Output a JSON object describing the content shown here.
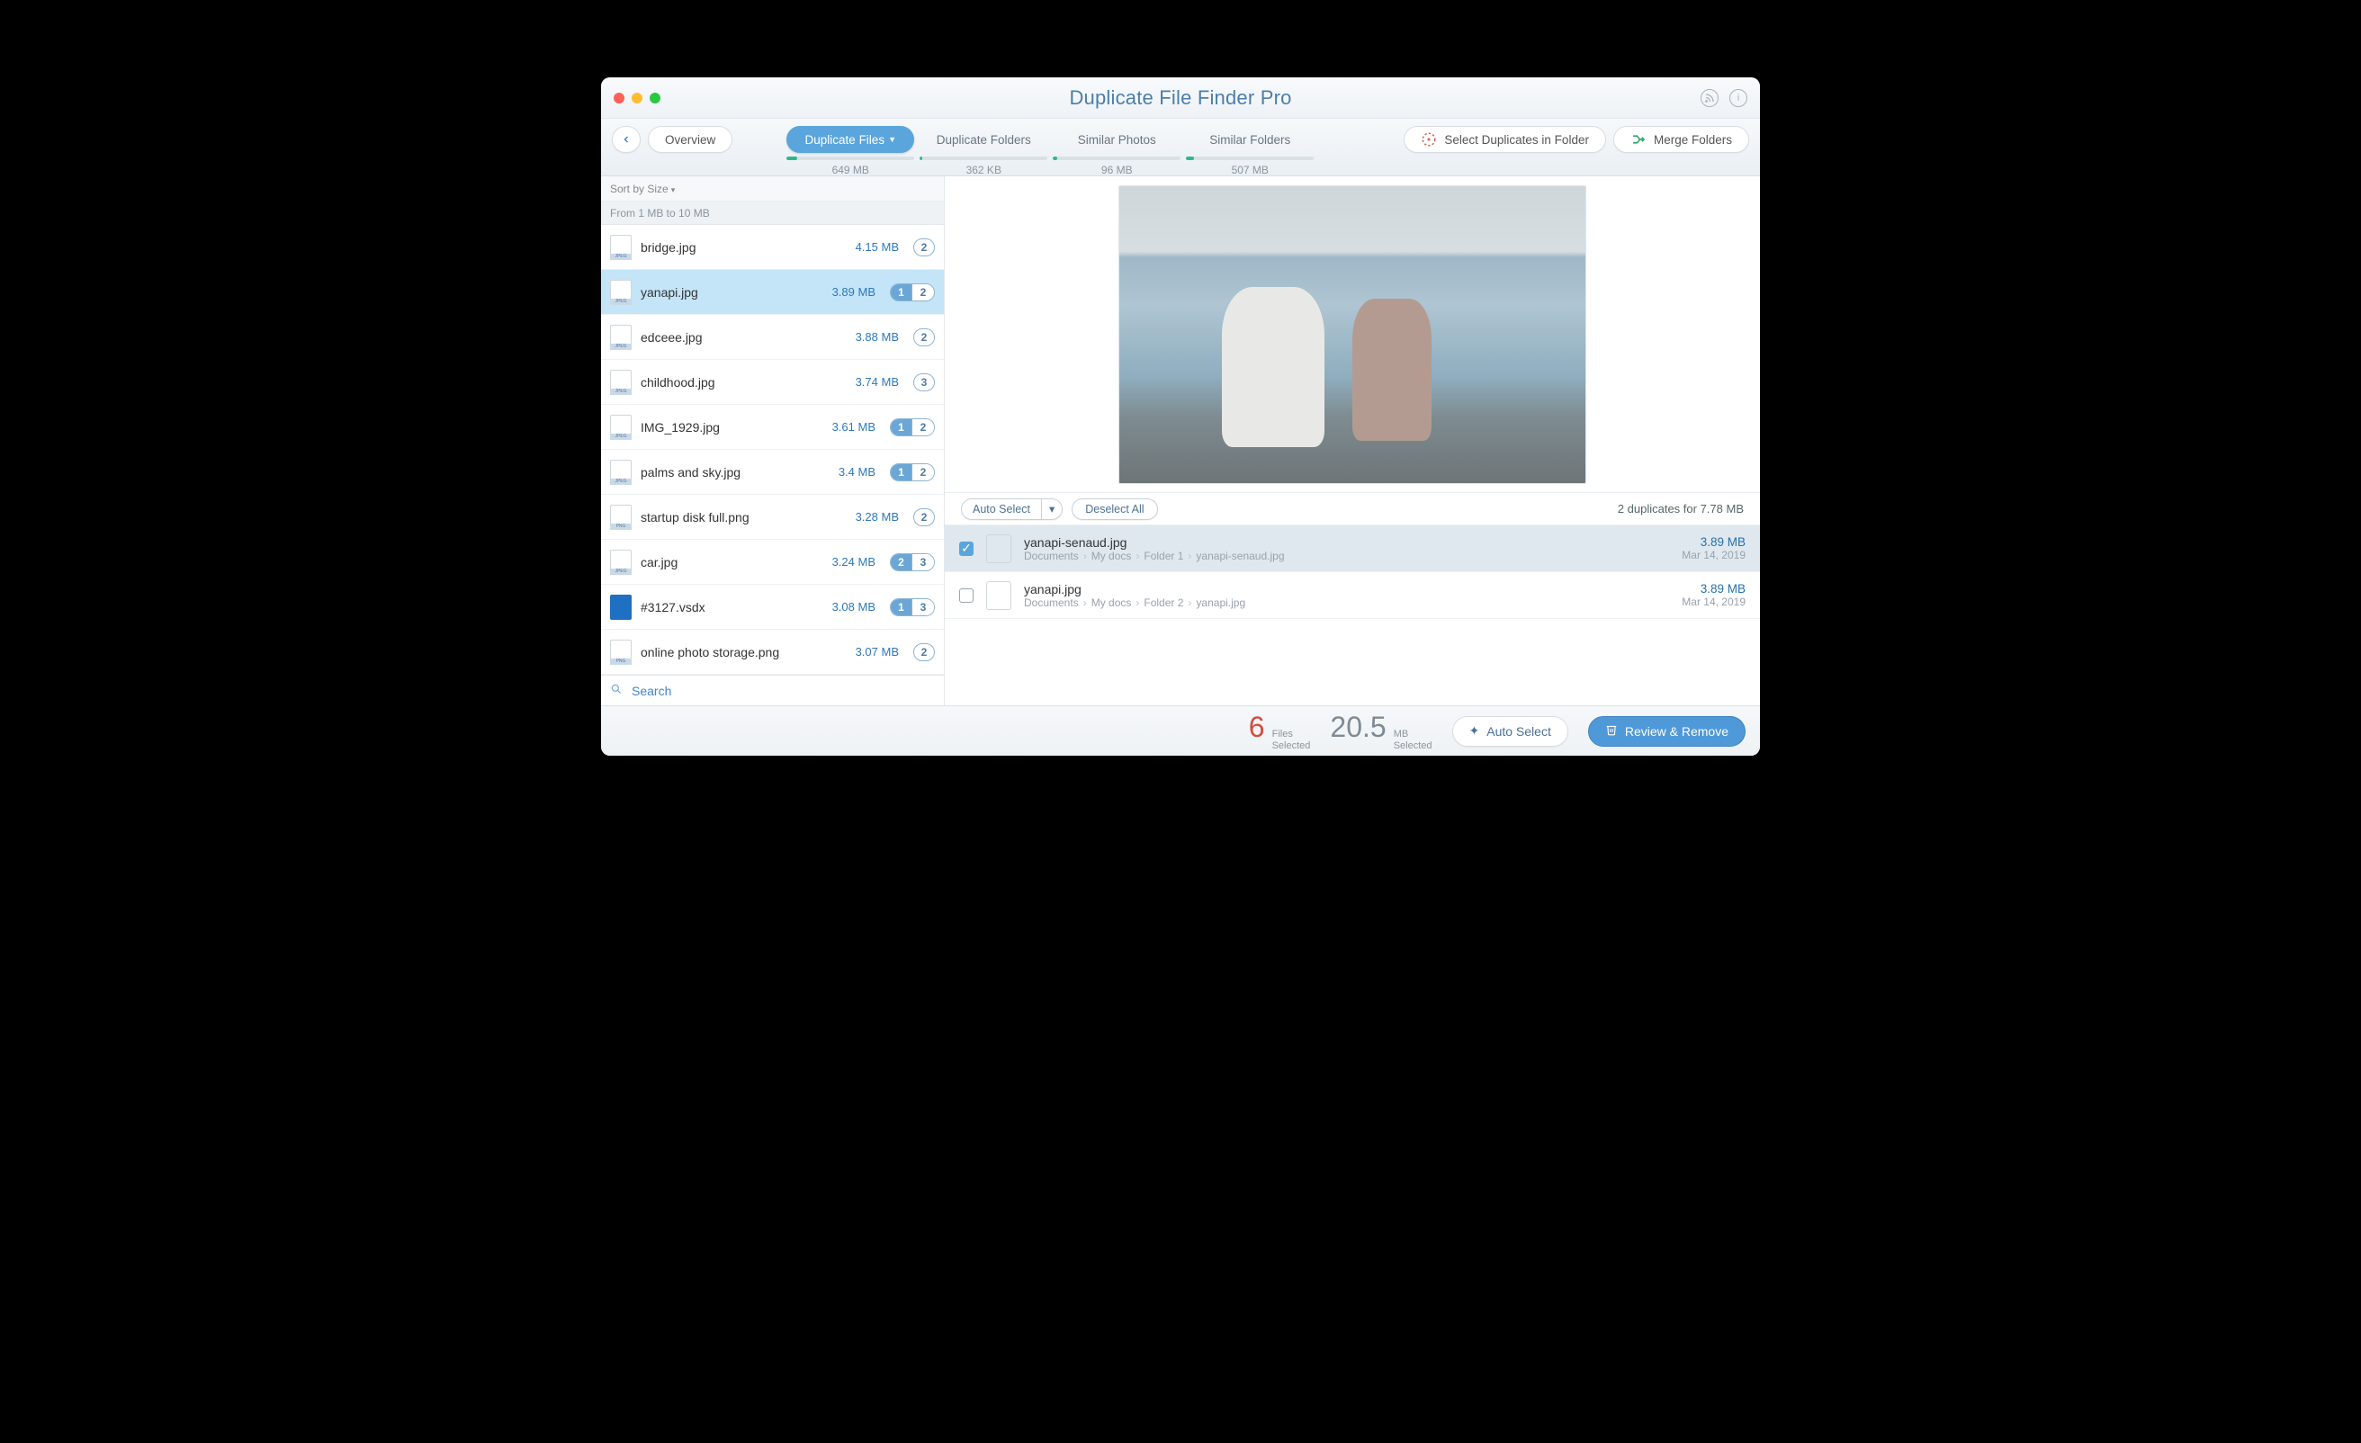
{
  "app_title": "Duplicate File Finder Pro",
  "toolbar": {
    "overview": "Overview",
    "select_in_folder": "Select Duplicates in Folder",
    "merge_folders": "Merge Folders"
  },
  "tabs": [
    {
      "label": "Duplicate Files",
      "size": "649 MB",
      "fill": 8,
      "active": true
    },
    {
      "label": "Duplicate Folders",
      "size": "362 KB",
      "fill": 2,
      "active": false
    },
    {
      "label": "Similar Photos",
      "size": "96 MB",
      "fill": 3,
      "active": false
    },
    {
      "label": "Similar Folders",
      "size": "507 MB",
      "fill": 6,
      "active": false
    }
  ],
  "sidebar": {
    "sort_label": "Sort by Size",
    "range_label": "From 1 MB to 10 MB",
    "search_label": "Search",
    "files": [
      {
        "name": "bridge.jpg",
        "size": "4.15 MB",
        "type": "jpeg",
        "badge": "2"
      },
      {
        "name": "yanapi.jpg",
        "size": "3.89 MB",
        "type": "jpeg",
        "pair": [
          "1",
          "2"
        ],
        "pairsel": 0,
        "selected": true
      },
      {
        "name": "edceee.jpg",
        "size": "3.88 MB",
        "type": "jpeg",
        "badge": "2"
      },
      {
        "name": "childhood.jpg",
        "size": "3.74 MB",
        "type": "jpeg",
        "badge": "3"
      },
      {
        "name": "IMG_1929.jpg",
        "size": "3.61 MB",
        "type": "jpeg",
        "pair": [
          "1",
          "2"
        ],
        "pairsel": 0
      },
      {
        "name": "palms and sky.jpg",
        "size": "3.4 MB",
        "type": "jpeg",
        "pair": [
          "1",
          "2"
        ],
        "pairsel": 0
      },
      {
        "name": "startup disk full.png",
        "size": "3.28 MB",
        "type": "png",
        "badge": "2"
      },
      {
        "name": "car.jpg",
        "size": "3.24 MB",
        "type": "jpeg",
        "pair": [
          "2",
          "3"
        ],
        "pairsel": 0
      },
      {
        "name": "#3127.vsdx",
        "size": "3.08 MB",
        "type": "vsdx",
        "pair": [
          "1",
          "3"
        ],
        "pairsel": 0
      },
      {
        "name": "online photo storage.png",
        "size": "3.07 MB",
        "type": "png",
        "badge": "2"
      }
    ]
  },
  "details": {
    "auto_select": "Auto Select",
    "deselect_all": "Deselect All",
    "summary": "2 duplicates for 7.78 MB",
    "items": [
      {
        "name": "yanapi-senaud.jpg",
        "path": [
          "Documents",
          "My docs",
          "Folder 1",
          "yanapi-senaud.jpg"
        ],
        "size": "3.89 MB",
        "date": "Mar 14, 2019",
        "checked": true,
        "selected": true
      },
      {
        "name": "yanapi.jpg",
        "path": [
          "Documents",
          "My docs",
          "Folder 2",
          "yanapi.jpg"
        ],
        "size": "3.89 MB",
        "date": "Mar 14, 2019",
        "checked": false
      }
    ]
  },
  "footer": {
    "files_count": "6",
    "files_label1": "Files",
    "files_label2": "Selected",
    "mb_count": "20.5",
    "mb_label1": "MB",
    "mb_label2": "Selected",
    "auto_select": "Auto Select",
    "review_remove": "Review & Remove"
  }
}
